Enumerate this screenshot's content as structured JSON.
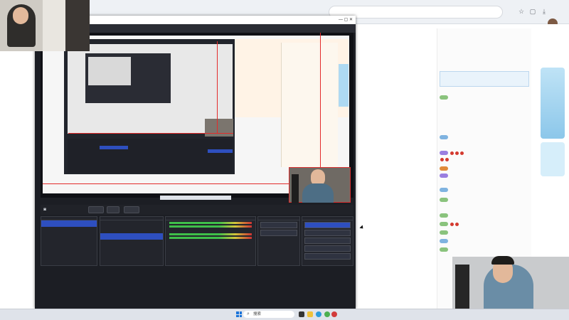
{
  "browser": {
    "toolbar_icons": [
      "back-icon",
      "reload-icon",
      "star-icon",
      "profile-icon"
    ]
  },
  "chat": {
    "tabs": [
      "",
      "",
      ""
    ],
    "notice": "",
    "lines": [
      "",
      "",
      "",
      "",
      "",
      "",
      "",
      "",
      "",
      "",
      "",
      "",
      "",
      "",
      "",
      "",
      "",
      "",
      "",
      "",
      "",
      ""
    ]
  },
  "obs": {
    "title": "",
    "menu": [
      "",
      "",
      "",
      "",
      "",
      ""
    ],
    "docks": {
      "scenes_title": "",
      "sources_title": "",
      "mixer_title": "",
      "transitions_title": "",
      "controls_title": ""
    },
    "controls": [
      "",
      "",
      "",
      "",
      ""
    ],
    "status": ""
  },
  "taskbar": {
    "search_label": "搜索"
  },
  "colors": {
    "accent": "#2e4fbf",
    "record_red": "#e32b2b",
    "taskbar": "#dfe3ea"
  }
}
